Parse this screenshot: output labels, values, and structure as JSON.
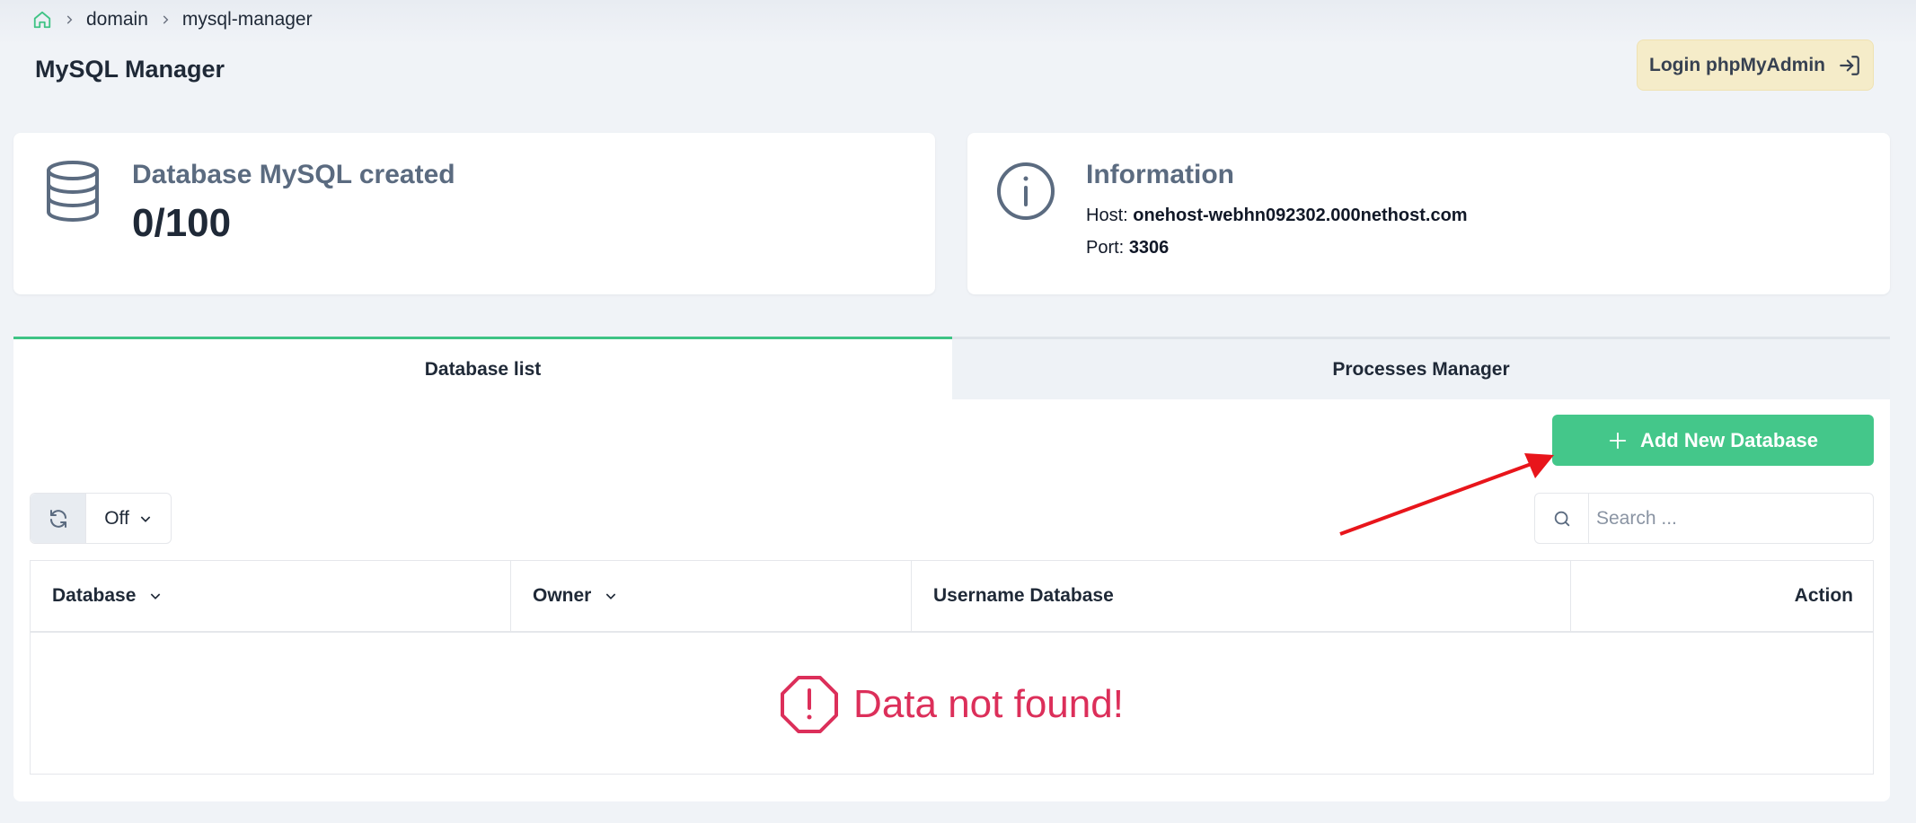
{
  "breadcrumb": {
    "home_icon": "home-icon",
    "items": [
      "domain",
      "mysql-manager"
    ]
  },
  "page": {
    "title": "MySQL Manager"
  },
  "header": {
    "login_label": "Login phpMyAdmin",
    "login_icon": "login-arrow-icon"
  },
  "stats": {
    "database": {
      "label": "Database MySQL created",
      "value": "0/100",
      "icon": "database-icon"
    },
    "info": {
      "label": "Information",
      "icon": "info-icon",
      "host_label": "Host:",
      "host_value": "onehost-webhn092302.000nethost.com",
      "port_label": "Port:",
      "port_value": "3306"
    }
  },
  "tabs": [
    {
      "label": "Database list",
      "active": true
    },
    {
      "label": "Processes Manager",
      "active": false
    }
  ],
  "toolbar": {
    "add_label": "Add New Database",
    "refresh_icon": "refresh-icon",
    "interval_value": "Off",
    "search_placeholder": "Search ..."
  },
  "table": {
    "columns": [
      {
        "label": "Database",
        "sortable": true
      },
      {
        "label": "Owner",
        "sortable": true
      },
      {
        "label": "Username Database",
        "sortable": false
      },
      {
        "label": "Action",
        "sortable": false
      }
    ],
    "empty_text": "Data not found!",
    "empty_icon": "alert-octagon-icon"
  },
  "colors": {
    "accent": "#44c78a",
    "login_bg": "#f5ecc9",
    "error": "#dc2f5a",
    "annotation_arrow": "#e8151b"
  }
}
